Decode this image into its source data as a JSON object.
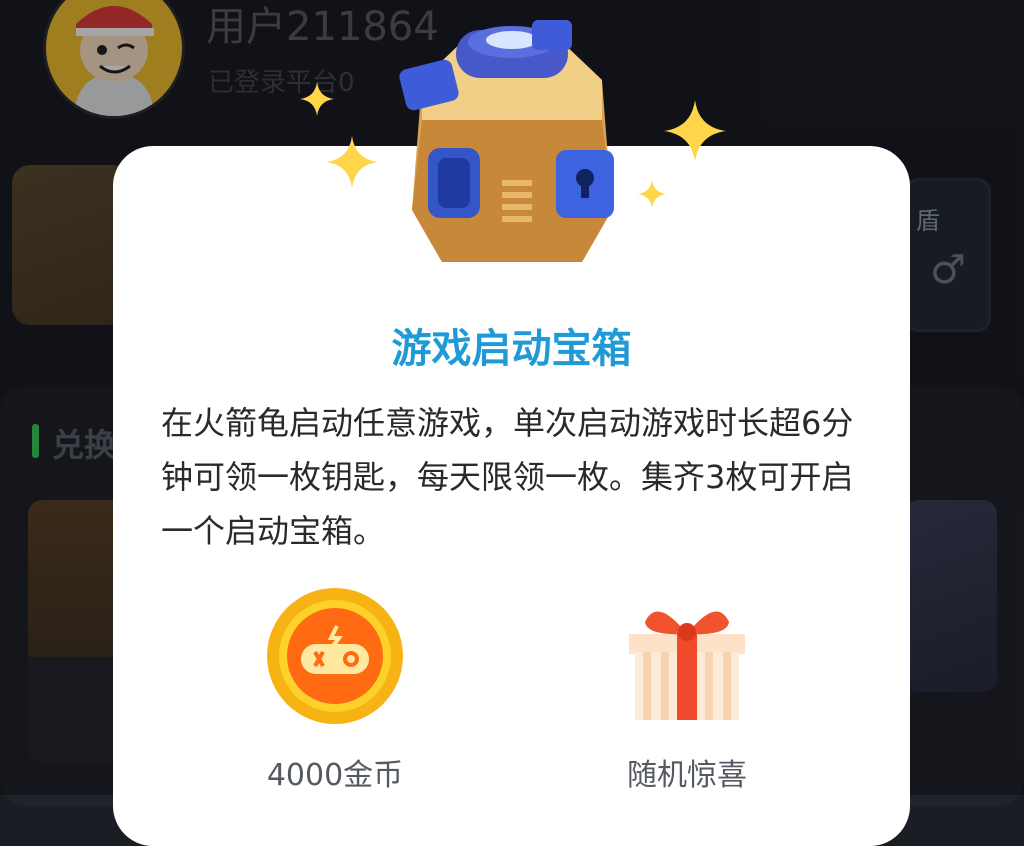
{
  "user": {
    "name": "用户211864",
    "platform_text": "已登录平台0"
  },
  "background": {
    "side_card_label": "盾",
    "side_card_symbol": "♂",
    "section_title": "兑换"
  },
  "modal": {
    "title": "游戏启动宝箱",
    "description": "在火箭龟启动任意游戏，单次启动游戏时长超6分钟可领一枚钥匙，每天限领一枚。集齐3枚可开启一个启动宝箱。",
    "rewards": [
      {
        "label": "4000金币",
        "icon": "coin-gamepad-icon"
      },
      {
        "label": "随机惊喜",
        "icon": "gift-box-icon"
      }
    ]
  },
  "colors": {
    "title": "#1e9ad6",
    "coin": "#f6b313",
    "coin_inner": "#ff6a13",
    "gift": "#f04a2a",
    "accent_green": "#3ccb5f"
  }
}
